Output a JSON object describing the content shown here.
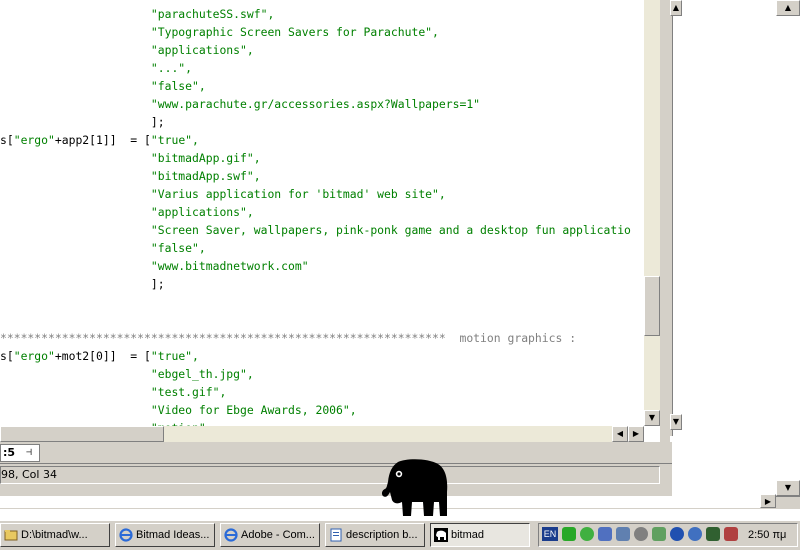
{
  "editor": {
    "lines": [
      {
        "top": 0,
        "left": 0,
        "segments": [
          {
            "c": "green",
            "t": "                      \"parachuteSS.swf\","
          }
        ]
      },
      {
        "top": 0,
        "left": 0,
        "segments": []
      },
      {
        "top": 0,
        "left": 0,
        "segments": []
      }
    ],
    "code": [
      [
        {
          "c": "green",
          "t": "                      \"parachuteSS.swf\","
        }
      ],
      [
        {
          "c": "green",
          "t": "                      \"Typographic Screen Savers for Parachute\","
        }
      ],
      [
        {
          "c": "green",
          "t": "                      \"applications\","
        }
      ],
      [
        {
          "c": "green",
          "t": "                      \"...\","
        }
      ],
      [
        {
          "c": "green",
          "t": "                      \"false\","
        }
      ],
      [
        {
          "c": "green",
          "t": "                      \"www.parachute.gr/accessories.aspx?Wallpapers=1\""
        }
      ],
      [
        {
          "c": "black",
          "t": "                      ];"
        }
      ],
      [
        {
          "c": "black",
          "t": "s["
        },
        {
          "c": "green",
          "t": "\"ergo\""
        },
        {
          "c": "black",
          "t": "+app2[1]]  = ["
        },
        {
          "c": "green",
          "t": "\"true\","
        }
      ],
      [
        {
          "c": "green",
          "t": "                      \"bitmadApp.gif\","
        }
      ],
      [
        {
          "c": "green",
          "t": "                      \"bitmadApp.swf\","
        }
      ],
      [
        {
          "c": "green",
          "t": "                      \"Varius application for 'bitmad' web site\","
        }
      ],
      [
        {
          "c": "green",
          "t": "                      \"applications\","
        }
      ],
      [
        {
          "c": "green",
          "t": "                      \"Screen Saver, wallpapers, pink-ponk game and a desktop fun applicatio"
        }
      ],
      [
        {
          "c": "green",
          "t": "                      \"false\","
        }
      ],
      [
        {
          "c": "green",
          "t": "                      \"www.bitmadnetwork.com\""
        }
      ],
      [
        {
          "c": "black",
          "t": "                      ];"
        }
      ],
      [
        {
          "c": "black",
          "t": ""
        }
      ],
      [
        {
          "c": "black",
          "t": ""
        }
      ],
      [
        {
          "c": "gray",
          "t": "*****************************************************************  motion graphics :"
        }
      ],
      [
        {
          "c": "black",
          "t": "s["
        },
        {
          "c": "green",
          "t": "\"ergo\""
        },
        {
          "c": "black",
          "t": "+mot2[0]]  = ["
        },
        {
          "c": "green",
          "t": "\"true\","
        }
      ],
      [
        {
          "c": "green",
          "t": "                      \"ebgel_th.jpg\","
        }
      ],
      [
        {
          "c": "green",
          "t": "                      \"test.gif\","
        }
      ],
      [
        {
          "c": "green",
          "t": "                      \"Video for Ebge Awards, 2006\","
        }
      ],
      [
        {
          "c": "green",
          "t": "                      \"motion\","
        }
      ]
    ]
  },
  "tab": {
    "label": ":5"
  },
  "status": {
    "text": "98, Col 34"
  },
  "taskbar": {
    "items": [
      {
        "label": "D:\\bitmad\\w...",
        "icon": "folder-icon"
      },
      {
        "label": "Bitmad Ideas...",
        "icon": "internet-explorer-icon"
      },
      {
        "label": "Adobe - Com...",
        "icon": "internet-explorer-icon"
      },
      {
        "label": "description b...",
        "icon": "document-icon"
      },
      {
        "label": "bitmad",
        "icon": "elephant-icon"
      }
    ],
    "language": "EN",
    "clock": "2:50 πμ"
  },
  "colors": {
    "string": "#008000",
    "code": "#000000",
    "comment": "#808080"
  }
}
